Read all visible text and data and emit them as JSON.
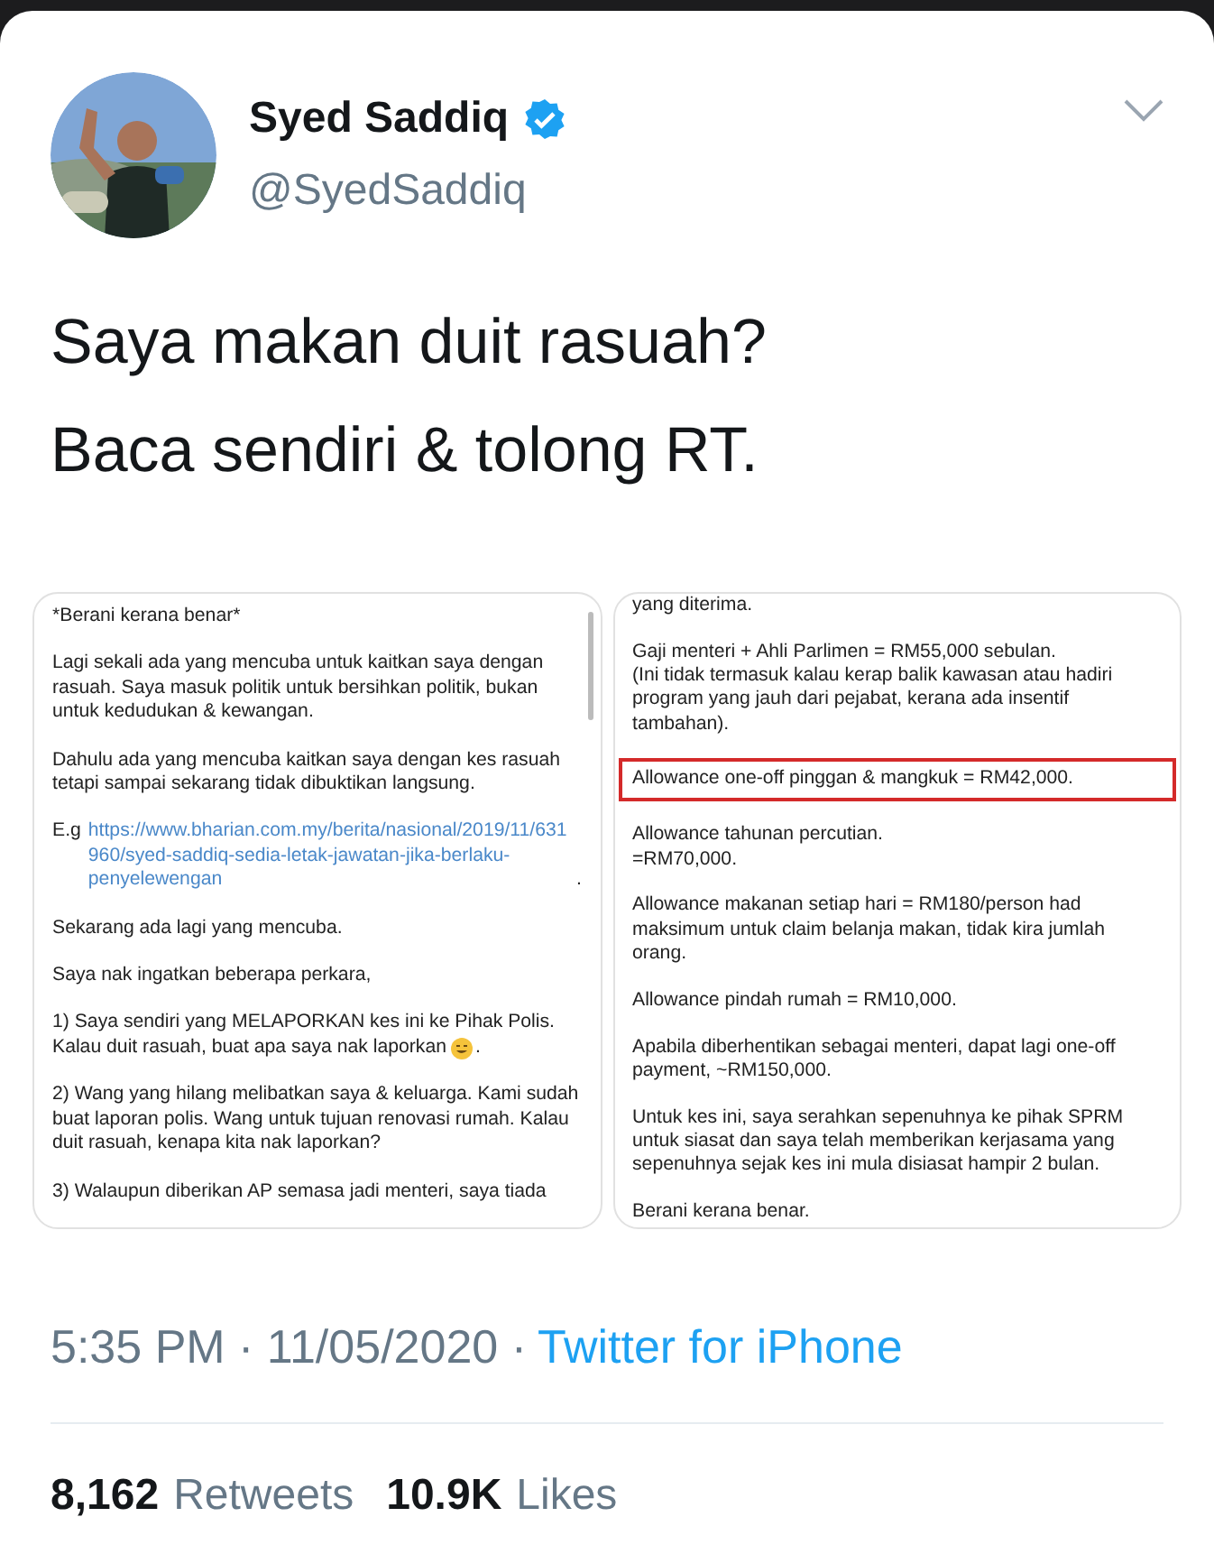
{
  "author": {
    "name": "Syed Saddiq",
    "handle": "@SyedSaddiq",
    "verified": true
  },
  "tweet_text": [
    "Saya makan duit rasuah?",
    "Baca sendiri & tolong RT."
  ],
  "left_image": [
    {
      "kind": "text",
      "text": "*Berani kerana benar*"
    },
    {
      "kind": "text",
      "text": "Lagi sekali ada yang mencuba untuk kaitkan saya dengan rasuah. Saya masuk politik untuk bersihkan politik, bukan untuk kedudukan & kewangan."
    },
    {
      "kind": "text",
      "text": "Dahulu ada yang mencuba kaitkan saya dengan kes rasuah tetapi sampai sekarang tidak dibuktikan langsung."
    },
    {
      "kind": "link",
      "prefix": "E.g",
      "url": "https://www.bharian.com.my/berita/nasional/2019/11/631960/syed-saddiq-sedia-letak-jawatan-jika-berlaku-penyelewengan",
      "suffix": "."
    },
    {
      "kind": "text",
      "text": "Sekarang ada lagi yang mencuba."
    },
    {
      "kind": "text",
      "text": "Saya nak ingatkan beberapa perkara,"
    },
    {
      "kind": "emoji",
      "lines": [
        "1) Saya sendiri yang MELAPORKAN kes ini ke Pihak Polis.",
        "Kalau duit rasuah, buat apa saya nak laporkan"
      ],
      "suffix": "."
    },
    {
      "kind": "text",
      "text": "2) Wang yang hilang melibatkan saya & keluarga. Kami sudah buat laporan polis. Wang untuk tujuan renovasi rumah. Kalau duit rasuah, kenapa kita nak laporkan?"
    },
    {
      "kind": "text",
      "text": "3) Walaupun diberikan AP semasa jadi menteri, saya tiada"
    }
  ],
  "right_image": [
    {
      "text": "yang diterima.",
      "highlighted": false
    },
    {
      "text": "Gaji menteri + Ahli Parlimen = RM55,000 sebulan.\n(Ini tidak termasuk kalau kerap balik kawasan atau hadiri program yang jauh dari pejabat, kerana ada insentif tambahan).",
      "highlighted": false
    },
    {
      "text": "Allowance one-off pinggan & mangkuk = RM42,000.",
      "highlighted": true
    },
    {
      "text": "Allowance tahunan percutian.\n=RM70,000.",
      "highlighted": false
    },
    {
      "text": "Allowance makanan setiap hari = RM180/person had maksimum untuk claim belanja makan, tidak kira jumlah orang.",
      "highlighted": false
    },
    {
      "text": "Allowance pindah rumah = RM10,000.",
      "highlighted": false
    },
    {
      "text": "Apabila diberhentikan sebagai menteri, dapat lagi one-off payment, ~RM150,000.",
      "highlighted": false
    },
    {
      "text": "Untuk kes ini, saya serahkan sepenuhnya ke pihak SPRM untuk siasat dan saya telah memberikan kerjasama yang sepenuhnya sejak kes ini mula disiasat hampir 2 bulan.",
      "highlighted": false
    },
    {
      "text": "Berani kerana benar.",
      "highlighted": false
    }
  ],
  "timestamp": "5:35 PM · 11/05/2020 ·",
  "source": "Twitter for iPhone",
  "stats": [
    {
      "count": "8,162",
      "label": "Retweets"
    },
    {
      "count": "10.9K",
      "label": "Likes"
    }
  ]
}
